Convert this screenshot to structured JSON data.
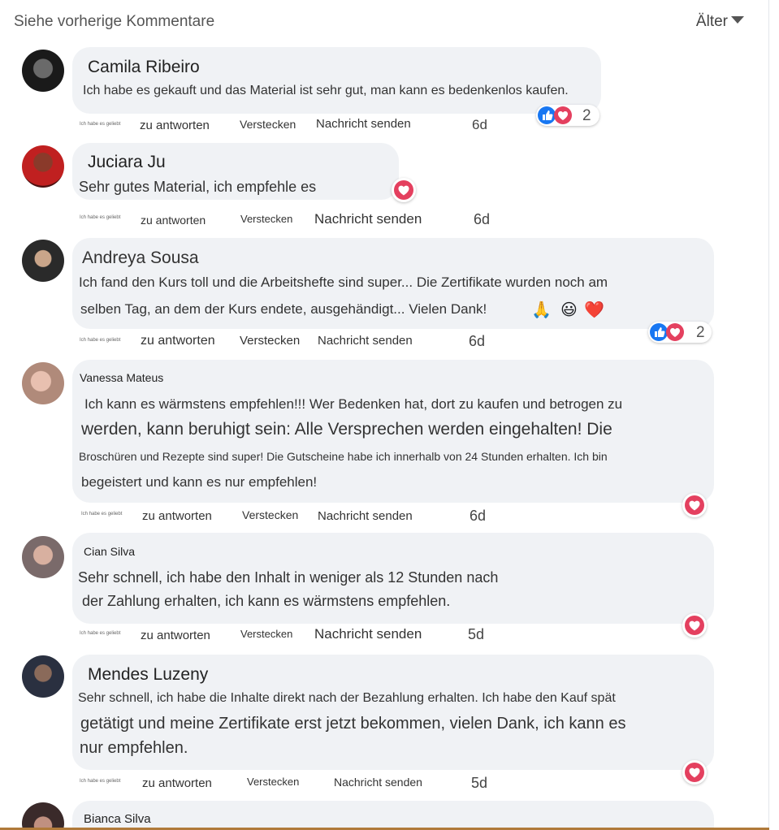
{
  "header": {
    "see_previous": "Siehe vorherige Kommentare",
    "sort_label": "Älter"
  },
  "actions": {
    "liked": "Ich habe es geliebt",
    "reply": "zu antworten",
    "hide": "Verstecken",
    "message": "Nachricht senden"
  },
  "colors": {
    "bubble": "#f0f2f5",
    "like_blue": "#1877f2",
    "love_red": "#e4405f"
  },
  "comments": [
    {
      "name": "Camila Ribeiro",
      "lines": [
        "Ich habe es gekauft und das Material ist sehr gut, man kann es bedenkenlos kaufen."
      ],
      "time": "6d",
      "reaction_count": "2",
      "reaction_icons": [
        "like-icon",
        "love-icon"
      ]
    },
    {
      "name": "Juciara Ju",
      "lines": [
        "Sehr gutes Material, ich empfehle es"
      ],
      "time": "6d",
      "reaction_icons": [
        "love-icon"
      ]
    },
    {
      "name": "Andreya Sousa",
      "lines": [
        "Ich fand den Kurs toll und die Arbeitshefte sind super... Die Zertifikate wurden noch am",
        "selben Tag, an dem der Kurs endete, ausgehändigt... Vielen Dank!"
      ],
      "emojis": [
        "🙏",
        "😃",
        "❤️"
      ],
      "time": "6d",
      "reaction_count": "2",
      "reaction_icons": [
        "like-icon",
        "love-icon"
      ]
    },
    {
      "name": "Vanessa Mateus",
      "lines": [
        "Ich kann es wärmstens empfehlen!!! Wer Bedenken hat, dort zu kaufen und betrogen zu",
        "werden, kann beruhigt sein: Alle Versprechen werden eingehalten! Die",
        "Broschüren und Rezepte sind super! Die Gutscheine habe ich innerhalb von 24 Stunden erhalten. Ich bin",
        "begeistert und kann es nur empfehlen!"
      ],
      "time": "6d",
      "reaction_icons": [
        "love-icon"
      ]
    },
    {
      "name": "Cian Silva",
      "lines": [
        "Sehr schnell, ich habe den Inhalt in weniger als 12 Stunden nach",
        "der Zahlung erhalten, ich kann es wärmstens empfehlen."
      ],
      "time": "5d",
      "reaction_icons": [
        "love-icon"
      ]
    },
    {
      "name": "Mendes Luzeny",
      "lines": [
        "Sehr schnell, ich habe die Inhalte direkt nach der Bezahlung erhalten. Ich habe den Kauf spät",
        "getätigt und meine Zertifikate erst jetzt bekommen, vielen Dank, ich kann es",
        "nur empfehlen."
      ],
      "time": "5d",
      "reaction_icons": [
        "love-icon"
      ]
    },
    {
      "name": "Bianca Silva",
      "lines": []
    }
  ]
}
